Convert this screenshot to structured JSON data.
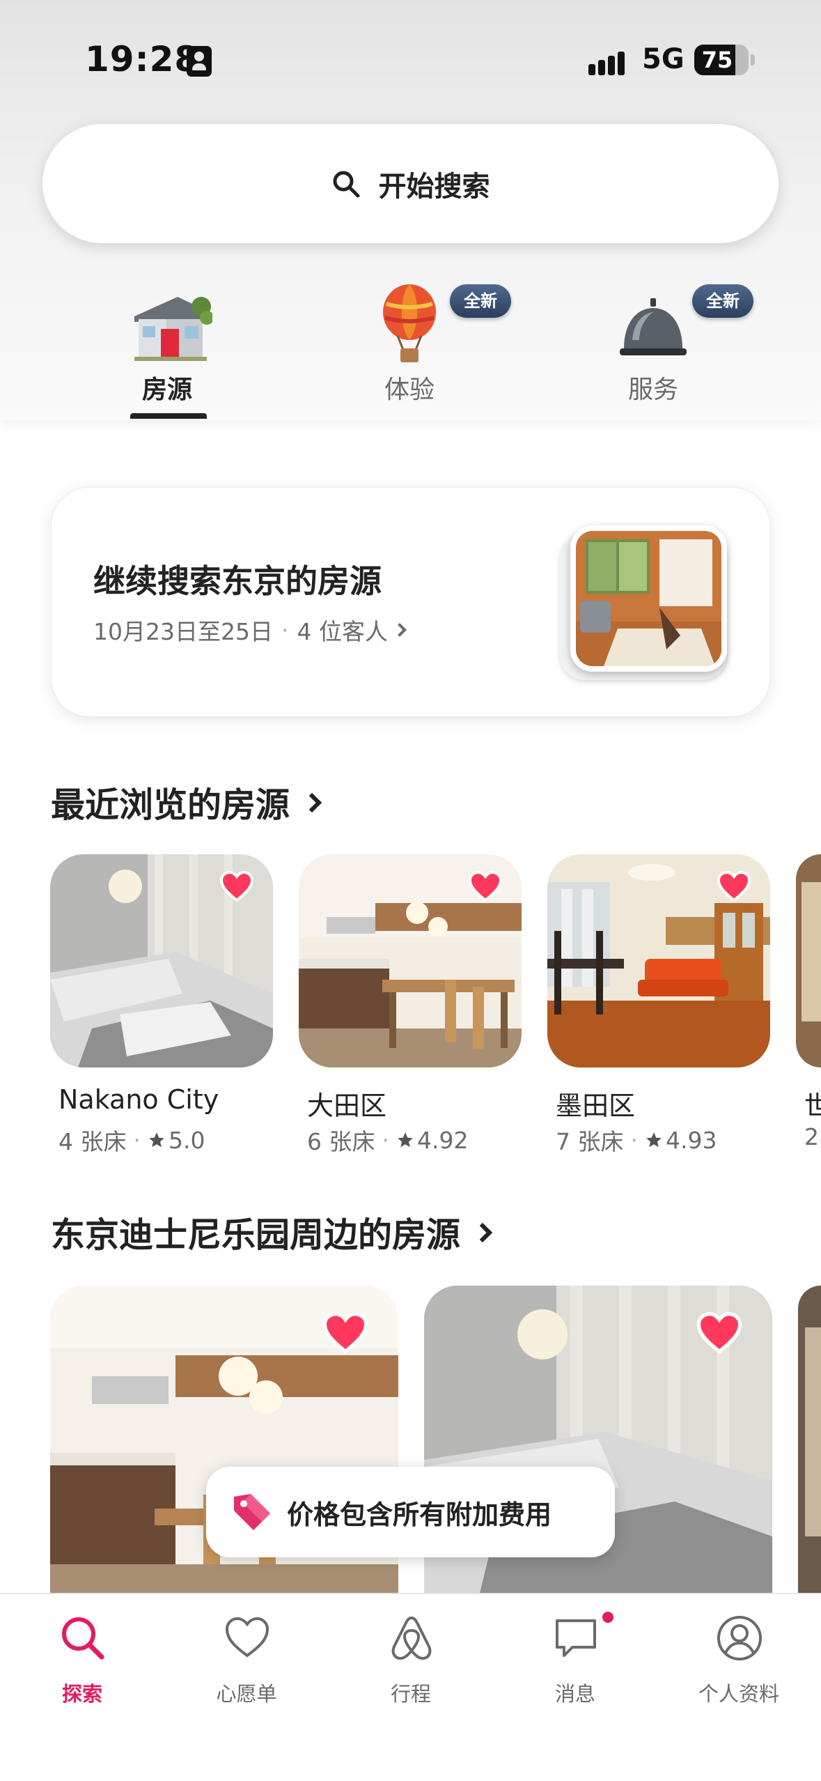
{
  "status_bar": {
    "time": "19:28",
    "network": "5G",
    "battery": "75",
    "battery_level": 0.75
  },
  "search": {
    "label": "开始搜索"
  },
  "categories": [
    {
      "label": "房源",
      "active": true,
      "icon": "house-icon"
    },
    {
      "label": "体验",
      "active": false,
      "icon": "hot-air-balloon-icon",
      "badge": "全新"
    },
    {
      "label": "服务",
      "active": false,
      "icon": "service-bell-icon",
      "badge": "全新"
    }
  ],
  "continue_search": {
    "title": "继续搜索东京的房源",
    "dates": "10月23日至25日",
    "separator": "·",
    "guests": "4 位客人"
  },
  "recent": {
    "title": "最近浏览的房源",
    "items": [
      {
        "name": "Nakano City",
        "beds": "4 张床",
        "rating": "5.0",
        "favorited": true
      },
      {
        "name": "大田区",
        "beds": "6 张床",
        "rating": "4.92",
        "favorited": true
      },
      {
        "name": "墨田区",
        "beds": "7 张床",
        "rating": "4.93",
        "favorited": true
      },
      {
        "name": "世",
        "beds": "2",
        "rating": "",
        "favorited": false
      }
    ]
  },
  "disney": {
    "title": "东京迪士尼乐园周边的房源"
  },
  "toast": {
    "label": "价格包含所有附加费用"
  },
  "bottom_nav": [
    {
      "label": "探索",
      "active": true,
      "icon": "search-icon"
    },
    {
      "label": "心愿单",
      "active": false,
      "icon": "heart-icon"
    },
    {
      "label": "行程",
      "active": false,
      "icon": "airbnb-logo-icon"
    },
    {
      "label": "消息",
      "active": false,
      "icon": "message-icon",
      "has_notification": true
    },
    {
      "label": "个人资料",
      "active": false,
      "icon": "profile-icon"
    }
  ],
  "colors": {
    "accent": "#e31c5f",
    "heart": "#ff385c",
    "text": "#222222",
    "muted": "#6a6a6a"
  }
}
